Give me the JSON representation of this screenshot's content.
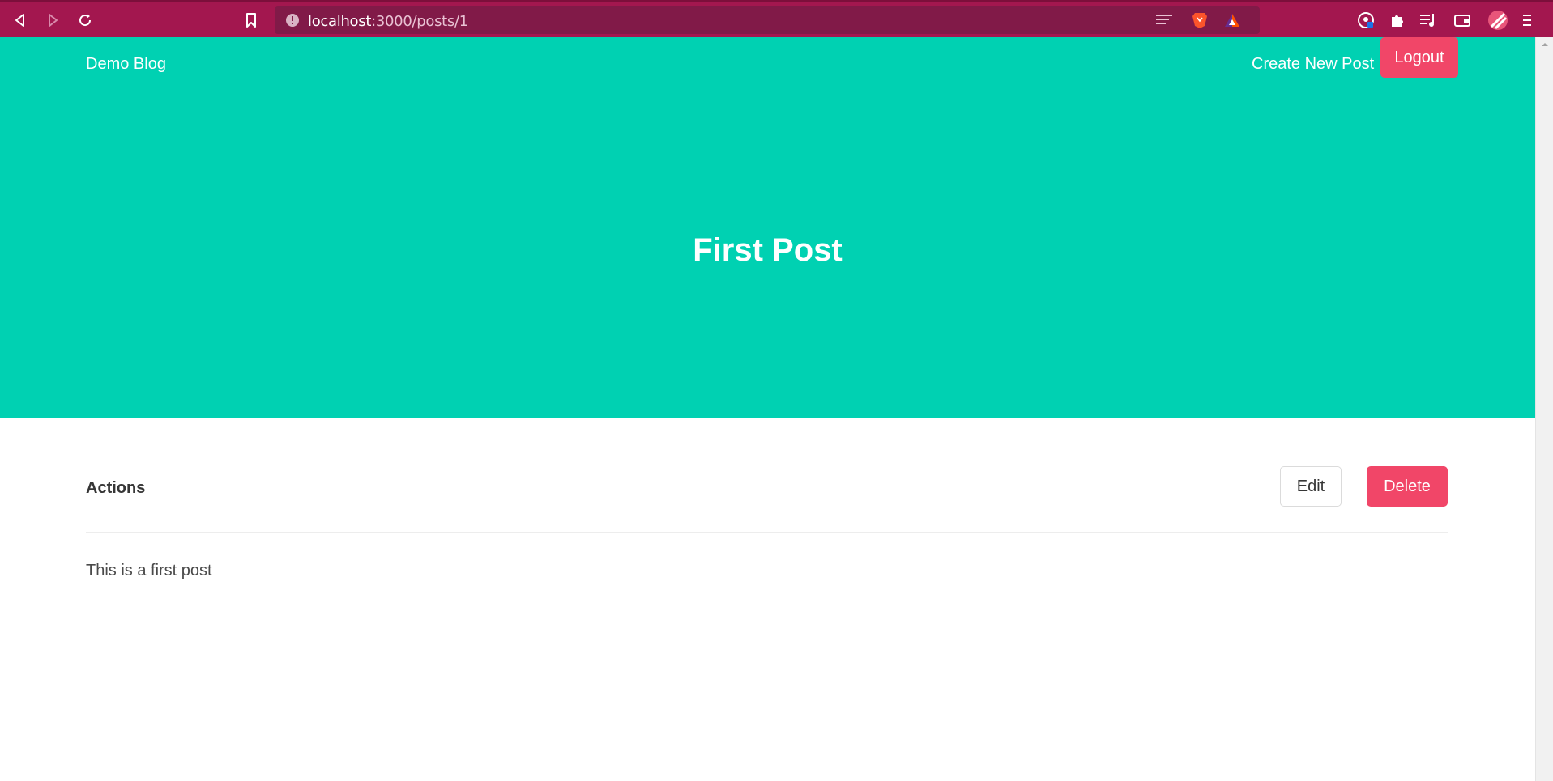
{
  "browser": {
    "url_host": "localhost",
    "url_rest": ":3000/posts/1"
  },
  "navbar": {
    "brand": "Demo Blog",
    "create_link": "Create New Post",
    "logout_label": "Logout"
  },
  "hero": {
    "title": "First Post"
  },
  "actions": {
    "label": "Actions",
    "edit_label": "Edit",
    "delete_label": "Delete"
  },
  "post": {
    "body": "This is a first post"
  },
  "colors": {
    "browser_bar": "#a3174f",
    "hero": "#00d1b2",
    "danger": "#f14668"
  }
}
